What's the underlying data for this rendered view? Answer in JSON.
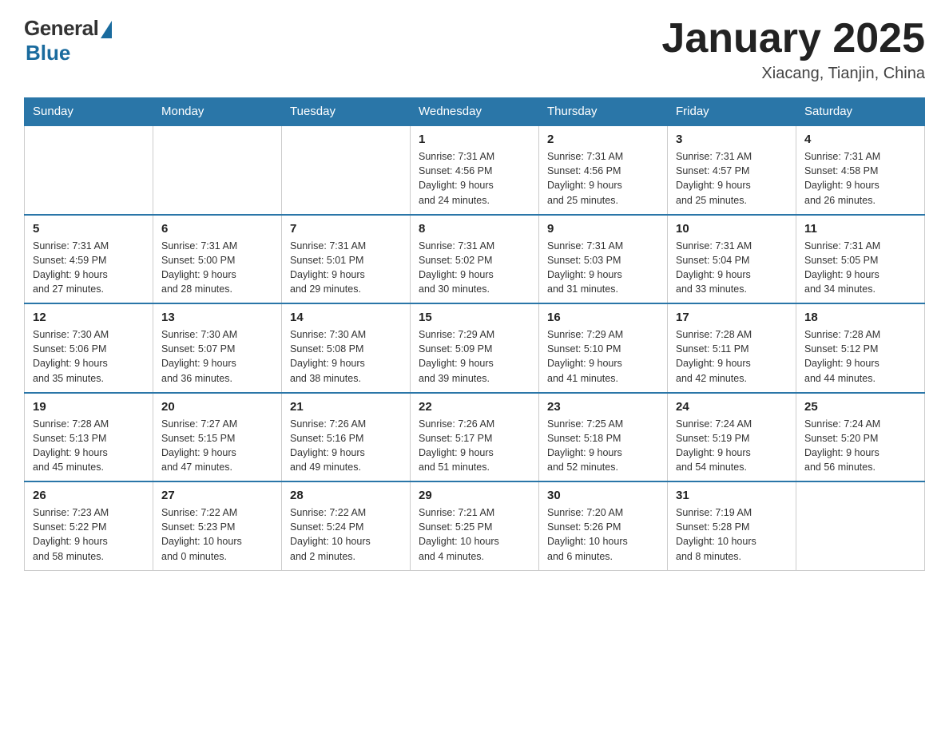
{
  "header": {
    "logo_general": "General",
    "logo_blue": "Blue",
    "month_title": "January 2025",
    "location": "Xiacang, Tianjin, China"
  },
  "days_of_week": [
    "Sunday",
    "Monday",
    "Tuesday",
    "Wednesday",
    "Thursday",
    "Friday",
    "Saturday"
  ],
  "weeks": [
    [
      {
        "day": "",
        "info": ""
      },
      {
        "day": "",
        "info": ""
      },
      {
        "day": "",
        "info": ""
      },
      {
        "day": "1",
        "info": "Sunrise: 7:31 AM\nSunset: 4:56 PM\nDaylight: 9 hours\nand 24 minutes."
      },
      {
        "day": "2",
        "info": "Sunrise: 7:31 AM\nSunset: 4:56 PM\nDaylight: 9 hours\nand 25 minutes."
      },
      {
        "day": "3",
        "info": "Sunrise: 7:31 AM\nSunset: 4:57 PM\nDaylight: 9 hours\nand 25 minutes."
      },
      {
        "day": "4",
        "info": "Sunrise: 7:31 AM\nSunset: 4:58 PM\nDaylight: 9 hours\nand 26 minutes."
      }
    ],
    [
      {
        "day": "5",
        "info": "Sunrise: 7:31 AM\nSunset: 4:59 PM\nDaylight: 9 hours\nand 27 minutes."
      },
      {
        "day": "6",
        "info": "Sunrise: 7:31 AM\nSunset: 5:00 PM\nDaylight: 9 hours\nand 28 minutes."
      },
      {
        "day": "7",
        "info": "Sunrise: 7:31 AM\nSunset: 5:01 PM\nDaylight: 9 hours\nand 29 minutes."
      },
      {
        "day": "8",
        "info": "Sunrise: 7:31 AM\nSunset: 5:02 PM\nDaylight: 9 hours\nand 30 minutes."
      },
      {
        "day": "9",
        "info": "Sunrise: 7:31 AM\nSunset: 5:03 PM\nDaylight: 9 hours\nand 31 minutes."
      },
      {
        "day": "10",
        "info": "Sunrise: 7:31 AM\nSunset: 5:04 PM\nDaylight: 9 hours\nand 33 minutes."
      },
      {
        "day": "11",
        "info": "Sunrise: 7:31 AM\nSunset: 5:05 PM\nDaylight: 9 hours\nand 34 minutes."
      }
    ],
    [
      {
        "day": "12",
        "info": "Sunrise: 7:30 AM\nSunset: 5:06 PM\nDaylight: 9 hours\nand 35 minutes."
      },
      {
        "day": "13",
        "info": "Sunrise: 7:30 AM\nSunset: 5:07 PM\nDaylight: 9 hours\nand 36 minutes."
      },
      {
        "day": "14",
        "info": "Sunrise: 7:30 AM\nSunset: 5:08 PM\nDaylight: 9 hours\nand 38 minutes."
      },
      {
        "day": "15",
        "info": "Sunrise: 7:29 AM\nSunset: 5:09 PM\nDaylight: 9 hours\nand 39 minutes."
      },
      {
        "day": "16",
        "info": "Sunrise: 7:29 AM\nSunset: 5:10 PM\nDaylight: 9 hours\nand 41 minutes."
      },
      {
        "day": "17",
        "info": "Sunrise: 7:28 AM\nSunset: 5:11 PM\nDaylight: 9 hours\nand 42 minutes."
      },
      {
        "day": "18",
        "info": "Sunrise: 7:28 AM\nSunset: 5:12 PM\nDaylight: 9 hours\nand 44 minutes."
      }
    ],
    [
      {
        "day": "19",
        "info": "Sunrise: 7:28 AM\nSunset: 5:13 PM\nDaylight: 9 hours\nand 45 minutes."
      },
      {
        "day": "20",
        "info": "Sunrise: 7:27 AM\nSunset: 5:15 PM\nDaylight: 9 hours\nand 47 minutes."
      },
      {
        "day": "21",
        "info": "Sunrise: 7:26 AM\nSunset: 5:16 PM\nDaylight: 9 hours\nand 49 minutes."
      },
      {
        "day": "22",
        "info": "Sunrise: 7:26 AM\nSunset: 5:17 PM\nDaylight: 9 hours\nand 51 minutes."
      },
      {
        "day": "23",
        "info": "Sunrise: 7:25 AM\nSunset: 5:18 PM\nDaylight: 9 hours\nand 52 minutes."
      },
      {
        "day": "24",
        "info": "Sunrise: 7:24 AM\nSunset: 5:19 PM\nDaylight: 9 hours\nand 54 minutes."
      },
      {
        "day": "25",
        "info": "Sunrise: 7:24 AM\nSunset: 5:20 PM\nDaylight: 9 hours\nand 56 minutes."
      }
    ],
    [
      {
        "day": "26",
        "info": "Sunrise: 7:23 AM\nSunset: 5:22 PM\nDaylight: 9 hours\nand 58 minutes."
      },
      {
        "day": "27",
        "info": "Sunrise: 7:22 AM\nSunset: 5:23 PM\nDaylight: 10 hours\nand 0 minutes."
      },
      {
        "day": "28",
        "info": "Sunrise: 7:22 AM\nSunset: 5:24 PM\nDaylight: 10 hours\nand 2 minutes."
      },
      {
        "day": "29",
        "info": "Sunrise: 7:21 AM\nSunset: 5:25 PM\nDaylight: 10 hours\nand 4 minutes."
      },
      {
        "day": "30",
        "info": "Sunrise: 7:20 AM\nSunset: 5:26 PM\nDaylight: 10 hours\nand 6 minutes."
      },
      {
        "day": "31",
        "info": "Sunrise: 7:19 AM\nSunset: 5:28 PM\nDaylight: 10 hours\nand 8 minutes."
      },
      {
        "day": "",
        "info": ""
      }
    ]
  ]
}
